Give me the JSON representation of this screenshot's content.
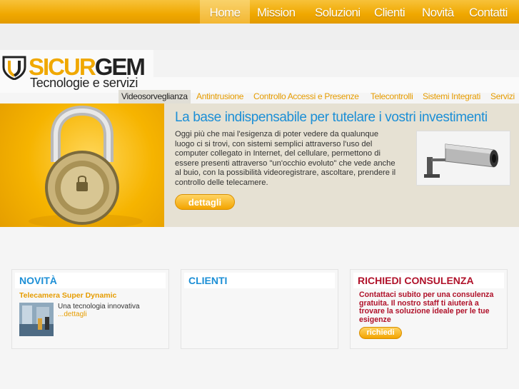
{
  "colors": {
    "accent": "#f0a800",
    "link_blue": "#1c8fd6",
    "consult_red": "#b0122a"
  },
  "nav": {
    "items": [
      {
        "label": "Home"
      },
      {
        "label": "Mission"
      },
      {
        "label": "Soluzioni"
      },
      {
        "label": "Clienti"
      },
      {
        "label": "Novità"
      },
      {
        "label": "Contatti"
      }
    ]
  },
  "logo": {
    "name_part1": "SICUR",
    "name_part2": "GEM",
    "tagline": "Tecnologie e servizi",
    "icon": "shield-icon"
  },
  "tabs": [
    {
      "label": "Videosorveglianza"
    },
    {
      "label": "Antintrusione"
    },
    {
      "label": "Controllo Accessi e Presenze"
    },
    {
      "label": "Telecontrolli"
    },
    {
      "label": "Sistemi Integrati"
    },
    {
      "label": "Servizi"
    }
  ],
  "hero": {
    "title": "La base indispensabile per tutelare i vostri investimenti",
    "text": "Oggi più che mai l'esigenza di poter vedere da qualunque luogo ci si trovi, con sistemi semplici attraverso l'uso del computer collegato in Internet, del cellulare, permettono di essere presenti attraverso \"un'occhio evoluto\" che vede anche al buio, con la possibilità videoregistrare, ascoltare, prendere il controllo delle telecamere.",
    "button": "dettagli",
    "image_icon": "padlock-icon",
    "camera_icon": "security-camera-icon"
  },
  "boxes": {
    "news": {
      "title": "NOVITÀ",
      "item_title": "Telecamera Super Dynamic",
      "item_text": "Una tecnologia innovativa",
      "item_more": "...dettagli"
    },
    "clients": {
      "title": "CLIENTI"
    },
    "consult": {
      "title": "RICHIEDI CONSULENZA",
      "text": "Contattaci subito per una consulenza gratuita. Il nostro staff ti aiuterà a trovare la soluzione ideale per le tue esigenze",
      "button": "richiedi"
    }
  }
}
